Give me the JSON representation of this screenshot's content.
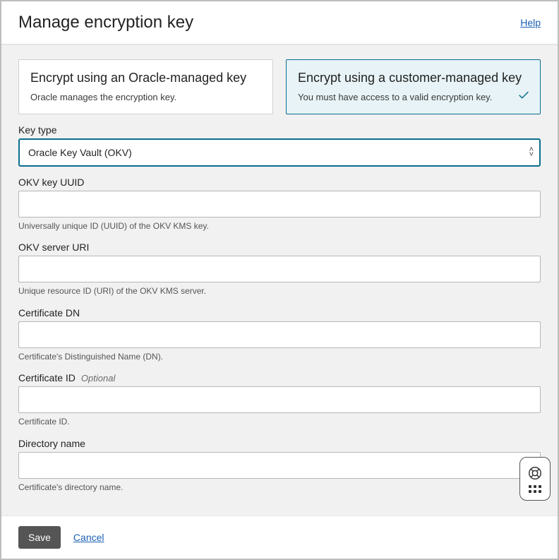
{
  "header": {
    "title": "Manage encryption key",
    "help": "Help"
  },
  "cards": {
    "oracle": {
      "title": "Encrypt using an Oracle-managed key",
      "desc": "Oracle manages the encryption key."
    },
    "customer": {
      "title": "Encrypt using a customer-managed key",
      "desc": "You must have access to a valid encryption key."
    }
  },
  "keyType": {
    "label": "Key type",
    "value": "Oracle Key Vault (OKV)"
  },
  "okvUuid": {
    "label": "OKV key UUID",
    "value": "",
    "helper": "Universally unique ID (UUID) of the OKV KMS key."
  },
  "okvUri": {
    "label": "OKV server URI",
    "value": "",
    "helper": "Unique resource ID (URI) of the OKV KMS server."
  },
  "certDn": {
    "label": "Certificate DN",
    "value": "",
    "helper": "Certificate's Distinguished Name (DN)."
  },
  "certId": {
    "label": "Certificate ID",
    "optional": "Optional",
    "value": "",
    "helper": "Certificate ID."
  },
  "dirName": {
    "label": "Directory name",
    "value": "",
    "helper": "Certificate's directory name."
  },
  "footer": {
    "save": "Save",
    "cancel": "Cancel"
  }
}
